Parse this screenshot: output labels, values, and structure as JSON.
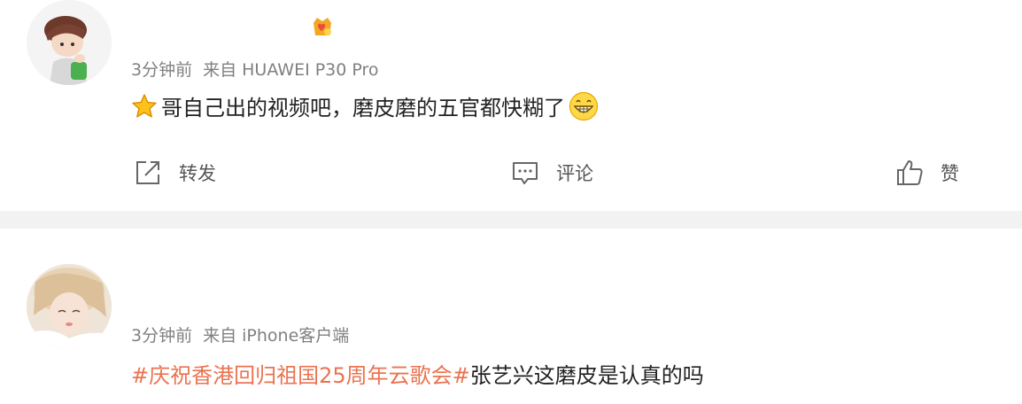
{
  "posts": [
    {
      "time": "3分钟前",
      "source": "来自 HUAWEI P30 Pro",
      "text": "哥自己出的视频吧，磨皮磨的五官都快糊了",
      "actions": {
        "forward": "转发",
        "comment": "评论",
        "like": "赞"
      }
    },
    {
      "time": "3分钟前",
      "source": "来自 iPhone客户端",
      "topic": "#庆祝香港回归祖国25周年云歌会#",
      "text": "张艺兴这磨皮是认真的吗"
    }
  ],
  "colors": {
    "topic": "#eb7350",
    "meta": "#808080",
    "separator": "#f2f2f2"
  },
  "icons": [
    "star-icon",
    "grin-emoji-icon",
    "fan-badge-icon",
    "forward-icon",
    "comment-icon",
    "like-icon"
  ]
}
